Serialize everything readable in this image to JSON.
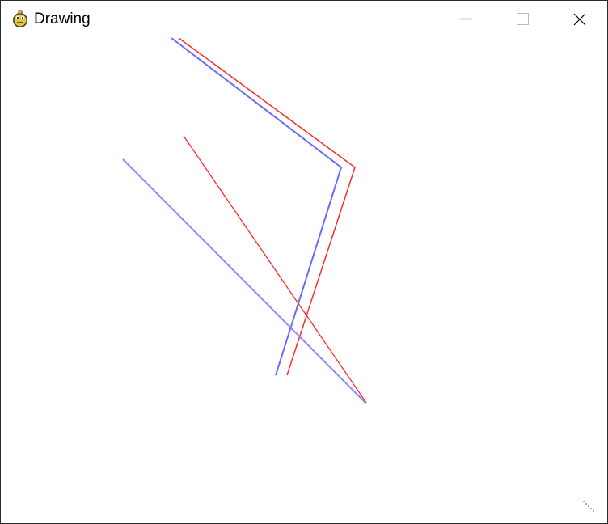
{
  "window": {
    "title": "Drawing",
    "icon": "python-snake-icon",
    "controls": [
      "minimize-icon",
      "maximize-icon",
      "close-icon"
    ]
  },
  "canvas": {
    "background": "#ffffff",
    "colors": {
      "blue": "#6a6aff",
      "red": "#ff2020"
    }
  }
}
